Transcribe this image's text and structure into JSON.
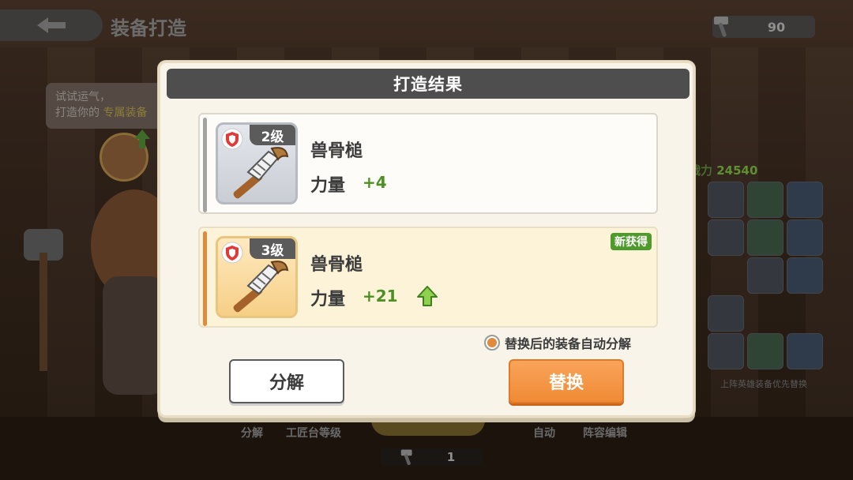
{
  "background": {
    "page_title": "装备打造",
    "resource_value": "90",
    "bubble_line1": "试试运气，",
    "bubble_line2_prefix": "打造你的",
    "bubble_line2_highlight": "专属装备",
    "power_label": "战力",
    "power_value": "24540",
    "hint_small": "上阵英雄装备优先替换",
    "bottom_decompose": "分解",
    "bottom_workbench": "工匠台等级",
    "bottom_auto": "自动",
    "bottom_formation": "阵容编辑",
    "counter_value": "1"
  },
  "dialog": {
    "title": "打造结果",
    "old_item": {
      "level": "2级",
      "name": "兽骨槌",
      "stat_label": "力量",
      "stat_value": "+4",
      "rarity_color": "#a3a3a3"
    },
    "new_item": {
      "level": "3级",
      "name": "兽骨槌",
      "stat_label": "力量",
      "stat_value": "+21",
      "badge": "新获得",
      "rarity_color": "#e08a3d"
    },
    "auto_option": "替换后的装备自动分解",
    "auto_option_checked": true,
    "decompose_button": "分解",
    "replace_button": "替换"
  },
  "colors": {
    "accent_orange": "#f08a35",
    "stat_green": "#4d8f22",
    "title_bar": "#4e4e4e"
  }
}
